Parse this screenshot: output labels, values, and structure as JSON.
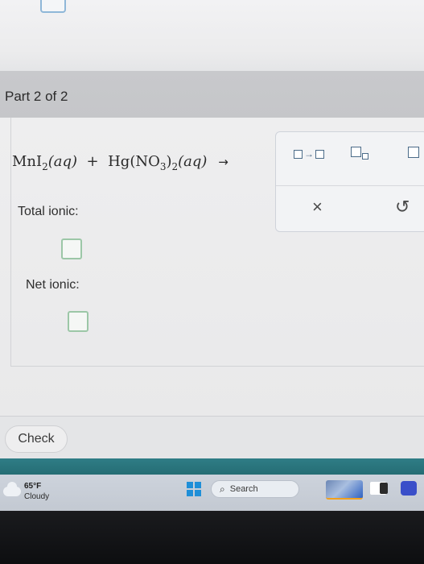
{
  "part_header": {
    "label": "Part 2 of 2"
  },
  "equation": {
    "reactant1_formula": "MnI",
    "reactant1_subscript": "2",
    "reactant1_state": "(aq)",
    "plus": "+",
    "reactant2_formula_a": "Hg(NO",
    "reactant2_subscript_inner": "3",
    "reactant2_formula_b": ")",
    "reactant2_subscript_outer": "2",
    "reactant2_state": "(aq)",
    "arrow": "→"
  },
  "labels": {
    "total_ionic": "Total ionic:",
    "net_ionic": "Net ionic:"
  },
  "toolbar": {
    "reaction_arrow_label": "□→□",
    "clear_glyph": "×",
    "undo_glyph": "↺"
  },
  "check_button": {
    "label": "Check"
  },
  "taskbar": {
    "weather_temp": "65°F",
    "weather_condition": "Cloudy",
    "search_label": "Search"
  }
}
